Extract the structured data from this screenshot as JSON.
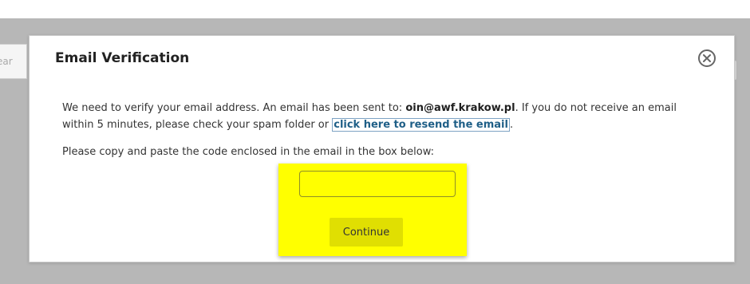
{
  "background": {
    "search_placeholder_fragment": "ear"
  },
  "modal": {
    "title": "Email Verification",
    "close_icon": "close-circle-icon",
    "message": {
      "before_email": "We need to verify your email address. An email has been sent to: ",
      "email": "oin@awf.krakow.pl",
      "after_email": ". If you do not receive an email within 5 minutes, please check your spam folder or ",
      "resend_link": "click here to resend the email",
      "end": "."
    },
    "instruction": "Please copy and paste the code enclosed in the email in the box below:",
    "code_input": {
      "value": "",
      "placeholder": ""
    },
    "continue_label": "Continue"
  },
  "colors": {
    "overlay": "#b7b7b7",
    "highlight": "#ffff00",
    "link": "#1f5f87",
    "button": "#e0df02"
  }
}
